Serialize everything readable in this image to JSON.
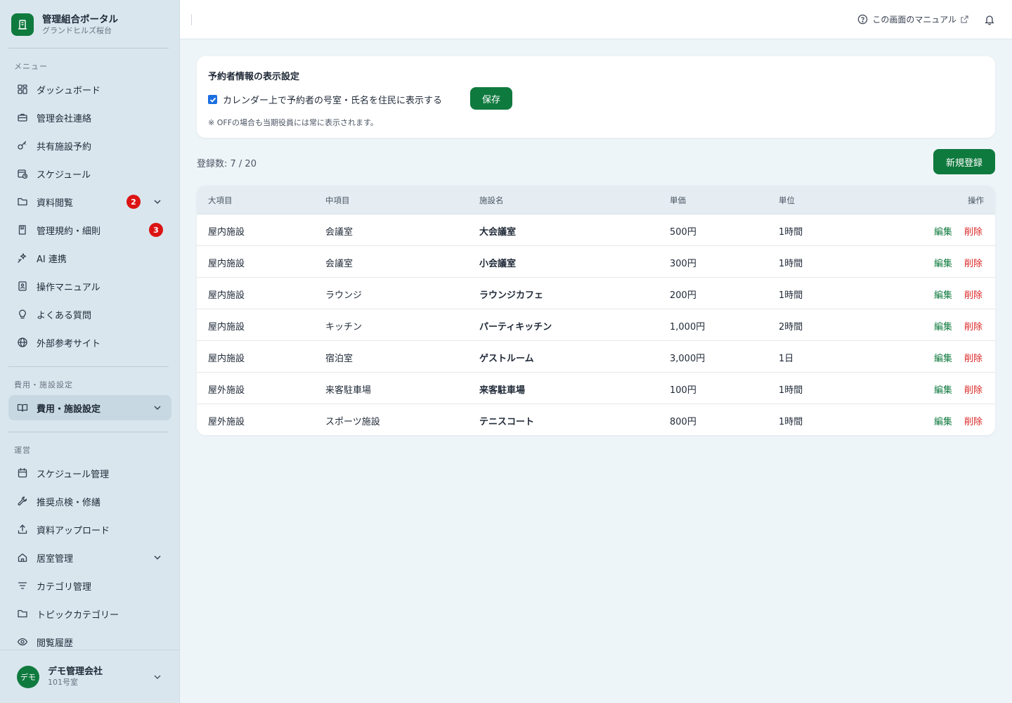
{
  "brand": {
    "title": "管理組合ポータル",
    "subtitle": "グランドヒルズ桜台",
    "icon": "building-icon"
  },
  "sections": {
    "menu": "メニュー",
    "fees": "費用・施設設定",
    "ops": "運営"
  },
  "menu_items": [
    {
      "label": "ダッシュボード",
      "icon": "dashboard-icon"
    },
    {
      "label": "管理会社連絡",
      "icon": "briefcase-icon"
    },
    {
      "label": "共有施設予約",
      "icon": "key-icon"
    },
    {
      "label": "スケジュール",
      "icon": "calendar-clock-icon"
    },
    {
      "label": "資料閲覧",
      "icon": "folder-icon",
      "badge": "2"
    },
    {
      "label": "管理規約・細則",
      "icon": "book-icon",
      "badge": "3"
    },
    {
      "label": "AI 連携",
      "icon": "sparkle-icon"
    },
    {
      "label": "操作マニュアル",
      "icon": "manual-icon"
    },
    {
      "label": "よくある質問",
      "icon": "lightbulb-icon"
    },
    {
      "label": "外部参考サイト",
      "icon": "globe-icon"
    }
  ],
  "fee_items": [
    {
      "label": "費用・施設設定",
      "icon": "open-book-icon",
      "active": true
    }
  ],
  "ops_items": [
    {
      "label": "スケジュール管理",
      "icon": "calendar-icon"
    },
    {
      "label": "推奨点検・修繕",
      "icon": "wrench-icon"
    },
    {
      "label": "資料アップロード",
      "icon": "upload-icon"
    },
    {
      "label": "居室管理",
      "icon": "home-icon"
    },
    {
      "label": "カテゴリ管理",
      "icon": "filter-icon"
    },
    {
      "label": "トピックカテゴリー",
      "icon": "folder-icon"
    },
    {
      "label": "閲覧履歴",
      "icon": "eye-icon"
    }
  ],
  "user": {
    "avatar": "デモ",
    "name": "デモ管理会社",
    "room": "101号室"
  },
  "header": {
    "manual_link": "この画面のマニュアル"
  },
  "settings": {
    "title": "予約者情報の表示設定",
    "checkbox_label": "カレンダー上で予約者の号室・氏名を住民に表示する",
    "checked": true,
    "save_label": "保存",
    "note": "※ OFFの場合も当期役員には常に表示されます。"
  },
  "count_text": "登録数: 7 / 20",
  "new_button": "新規登録",
  "table": {
    "headers": {
      "major": "大項目",
      "minor": "中項目",
      "name": "施設名",
      "price": "単価",
      "unit": "単位",
      "actions": "操作"
    },
    "edit_label": "編集",
    "delete_label": "削除",
    "rows": [
      {
        "major": "屋内施設",
        "minor": "会議室",
        "name": "大会議室",
        "price": "500円",
        "unit": "1時間"
      },
      {
        "major": "屋内施設",
        "minor": "会議室",
        "name": "小会議室",
        "price": "300円",
        "unit": "1時間"
      },
      {
        "major": "屋内施設",
        "minor": "ラウンジ",
        "name": "ラウンジカフェ",
        "price": "200円",
        "unit": "1時間"
      },
      {
        "major": "屋内施設",
        "minor": "キッチン",
        "name": "パーティキッチン",
        "price": "1,000円",
        "unit": "2時間"
      },
      {
        "major": "屋内施設",
        "minor": "宿泊室",
        "name": "ゲストルーム",
        "price": "3,000円",
        "unit": "1日"
      },
      {
        "major": "屋外施設",
        "minor": "来客駐車場",
        "name": "来客駐車場",
        "price": "100円",
        "unit": "1時間"
      },
      {
        "major": "屋外施設",
        "minor": "スポーツ施設",
        "name": "テニスコート",
        "price": "800円",
        "unit": "1時間"
      }
    ]
  },
  "colors": {
    "accent": "#0f7a3e",
    "danger": "#dc2626",
    "sidebar": "#d9e6ee",
    "badge": "#dc1414"
  }
}
